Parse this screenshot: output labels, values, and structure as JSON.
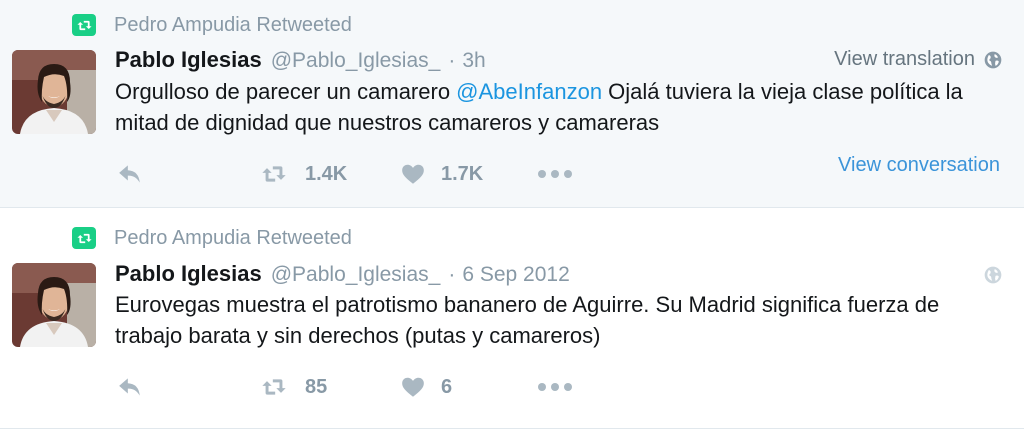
{
  "tweets": [
    {
      "retweeted_by": "Pedro Ampudia Retweeted",
      "name": "Pablo Iglesias",
      "handle": "@Pablo_Iglesias_",
      "separator": "·",
      "time": "3h",
      "translate_label": "View translation",
      "text_before": "Orgulloso de parecer un camarero ",
      "mention": "@AbeInfanzon",
      "text_after": " Ojalá tuviera la vieja clase política la mitad de dignidad que nuestros camareros y camareras",
      "retweets": "1.4K",
      "likes": "1.7K",
      "view_conversation": "View conversation"
    },
    {
      "retweeted_by": "Pedro Ampudia Retweeted",
      "name": "Pablo Iglesias",
      "handle": "@Pablo_Iglesias_",
      "separator": "·",
      "time": "6 Sep 2012",
      "text": "Eurovegas muestra el patrotismo bananero de Aguirre. Su Madrid significa fuerza de trabajo barata y sin derechos (putas y camareros)",
      "retweets": "85",
      "likes": "6"
    }
  ],
  "colors": {
    "retweet_green": "#19cf86",
    "link_blue": "#1b95e0",
    "muted_gray": "#8899a6",
    "highlight_bg": "#f5f8fa"
  },
  "icons": {
    "retweet_badge": "retweet-icon",
    "reply": "reply-icon",
    "retweet": "retweet-icon",
    "like": "heart-icon",
    "more": "more-icon",
    "globe": "globe-icon"
  }
}
